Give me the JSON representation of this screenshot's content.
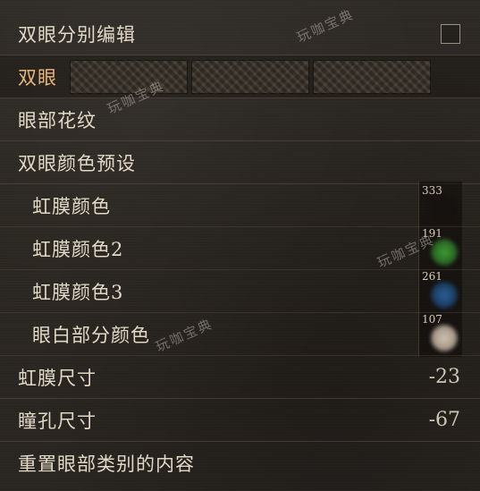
{
  "rows": {
    "separate_edit": {
      "label": "双眼分别编辑"
    },
    "both_eyes": {
      "label": "双眼"
    },
    "eye_pattern": {
      "label": "眼部花纹"
    },
    "eye_color_preset": {
      "label": "双眼颜色预设"
    },
    "iris_color": {
      "label": "虹膜颜色",
      "number": "333",
      "color": "#15120f"
    },
    "iris_color2": {
      "label": "虹膜颜色2",
      "number": "191",
      "color": "#2f7a2a"
    },
    "iris_color3": {
      "label": "虹膜颜色3",
      "number": "261",
      "color": "#1f4a7a"
    },
    "sclera_color": {
      "label": "眼白部分颜色",
      "number": "107",
      "color": "#b7aa9c"
    },
    "iris_size": {
      "label": "虹膜尺寸",
      "value": "-23"
    },
    "pupil_size": {
      "label": "瞳孔尺寸",
      "value": "-67"
    },
    "reset": {
      "label": "重置眼部类别的内容"
    }
  },
  "watermark": "玩咖宝典"
}
